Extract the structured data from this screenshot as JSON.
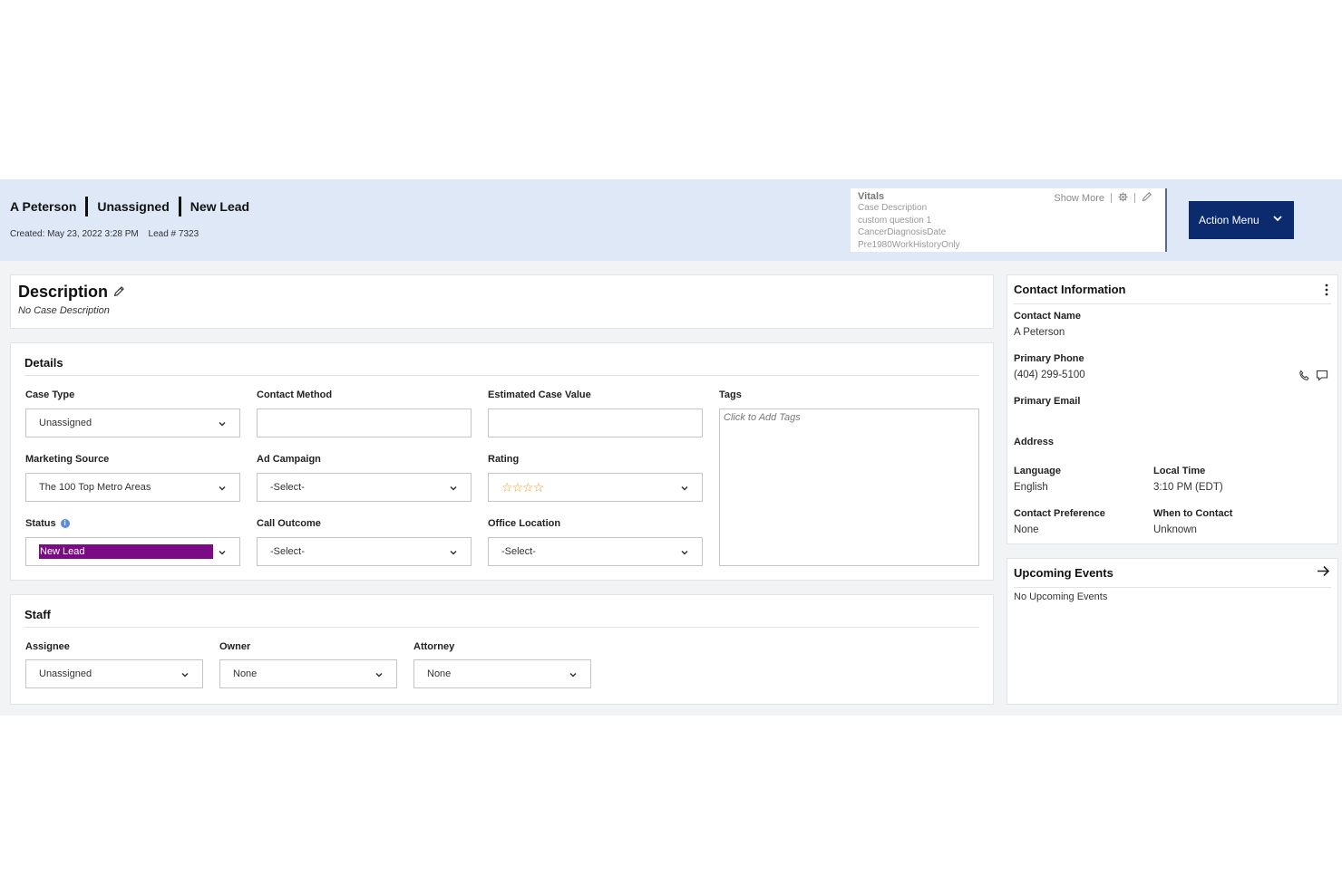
{
  "header": {
    "crumbs": [
      "A Peterson",
      "Unassigned",
      "New Lead"
    ],
    "created": "Created: May 23, 2022 3:28 PM",
    "lead": "Lead # 7323"
  },
  "vitals": {
    "title": "Vitals",
    "show_more": "Show More",
    "items": [
      "Case Description",
      "custom question 1",
      "CancerDiagnosisDate",
      "Pre1980WorkHistoryOnly"
    ]
  },
  "action_menu": {
    "label": "Action Menu"
  },
  "description": {
    "title": "Description",
    "text": "No Case Description"
  },
  "details": {
    "title": "Details",
    "case_type": {
      "label": "Case Type",
      "value": "Unassigned"
    },
    "contact_method": {
      "label": "Contact Method",
      "value": ""
    },
    "estimated_case_value": {
      "label": "Estimated Case Value",
      "value": ""
    },
    "tags": {
      "label": "Tags",
      "placeholder": "Click to Add Tags"
    },
    "marketing_source": {
      "label": "Marketing Source",
      "value": "The 100 Top Metro Areas"
    },
    "ad_campaign": {
      "label": "Ad Campaign",
      "value": "-Select-"
    },
    "rating": {
      "label": "Rating",
      "stars": "☆☆☆☆",
      "value": 0
    },
    "status": {
      "label": "Status",
      "value": "New Lead",
      "color": "#7b0a85"
    },
    "call_outcome": {
      "label": "Call Outcome",
      "value": "-Select-"
    },
    "office_location": {
      "label": "Office Location",
      "value": "-Select-"
    }
  },
  "staff": {
    "title": "Staff",
    "assignee": {
      "label": "Assignee",
      "value": "Unassigned"
    },
    "owner": {
      "label": "Owner",
      "value": "None"
    },
    "attorney": {
      "label": "Attorney",
      "value": "None"
    }
  },
  "contact": {
    "title": "Contact Information",
    "contact_name_label": "Contact Name",
    "contact_name": "A Peterson",
    "primary_phone_label": "Primary Phone",
    "primary_phone": "(404) 299-5100",
    "primary_email_label": "Primary Email",
    "address_label": "Address",
    "language_label": "Language",
    "language": "English",
    "local_time_label": "Local Time",
    "local_time": "3:10 PM (EDT)",
    "contact_preference_label": "Contact Preference",
    "contact_preference": "None",
    "when_to_contact_label": "When to Contact",
    "when_to_contact": "Unknown"
  },
  "upcoming": {
    "title": "Upcoming Events",
    "empty": "No Upcoming Events"
  },
  "colors": {
    "header_bg": "#dfe8f6",
    "action_button": "#0c2a6e",
    "status_badge": "#7b0a85",
    "star": "#f0a020"
  },
  "icons": [
    "pencil-icon",
    "gear-icon",
    "chevron-down-icon",
    "info-icon",
    "star-icon",
    "kebab-icon",
    "phone-icon",
    "message-icon",
    "arrow-right-icon"
  ]
}
